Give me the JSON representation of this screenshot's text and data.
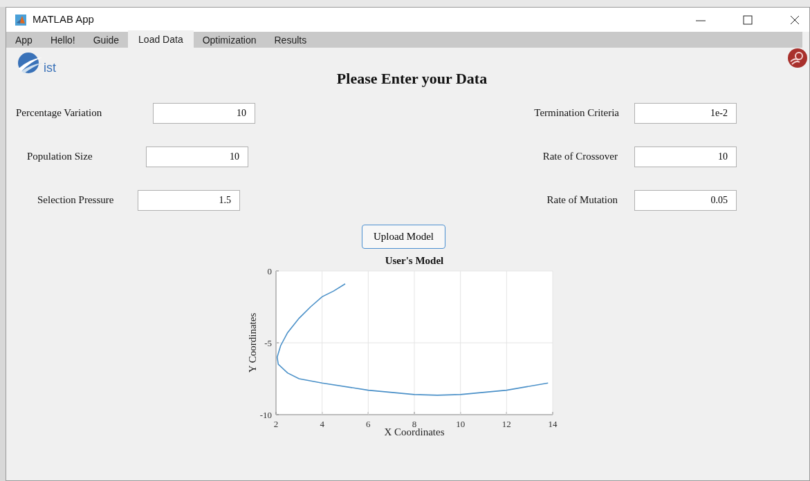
{
  "window": {
    "title": "MATLAB App"
  },
  "tabs": [
    {
      "label": "App",
      "selected": false
    },
    {
      "label": "Hello!",
      "selected": false
    },
    {
      "label": "Guide",
      "selected": false
    },
    {
      "label": "Load Data",
      "selected": true
    },
    {
      "label": "Optimization",
      "selected": false
    },
    {
      "label": "Results",
      "selected": false
    }
  ],
  "logo": {
    "text": "ist"
  },
  "heading": "Please Enter your Data",
  "fields_left": [
    {
      "label": "Percentage Variation",
      "value": "10"
    },
    {
      "label": "Population Size",
      "value": "10"
    },
    {
      "label": "Selection Pressure",
      "value": "1.5"
    }
  ],
  "fields_right": [
    {
      "label": "Termination Criteria",
      "value": "1e-2"
    },
    {
      "label": "Rate of Crossover",
      "value": "10"
    },
    {
      "label": "Rate of Mutation",
      "value": "0.05"
    }
  ],
  "upload_button": "Upload Model",
  "chart_data": {
    "type": "line",
    "title": "User's Model",
    "xlabel": "X Coordinates",
    "ylabel": "Y Coordinates",
    "xlim": [
      2,
      14
    ],
    "ylim": [
      -10,
      0
    ],
    "grid": true,
    "xticks": [
      2,
      4,
      6,
      8,
      10,
      12,
      14
    ],
    "yticks": [
      -10,
      -5,
      0
    ],
    "x": [
      5,
      4.5,
      4,
      3.5,
      3,
      2.5,
      2.2,
      2.05,
      2.1,
      2.5,
      3,
      4,
      6,
      8,
      9,
      10,
      12,
      13.8
    ],
    "series": [
      {
        "color": "#4a90c8",
        "values": [
          -0.9,
          -1.4,
          -1.8,
          -2.5,
          -3.3,
          -4.3,
          -5.2,
          -6,
          -6.5,
          -7.1,
          -7.5,
          -7.8,
          -8.3,
          -8.6,
          -8.65,
          -8.6,
          -8.3,
          -7.8
        ]
      }
    ]
  }
}
